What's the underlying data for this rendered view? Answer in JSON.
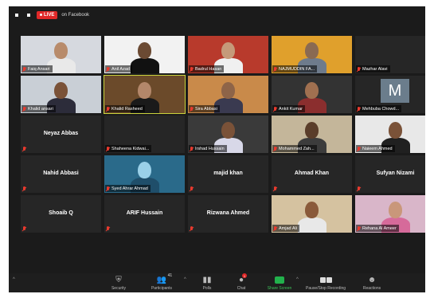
{
  "live": {
    "badge": "LIVE",
    "destination": "on Facebook"
  },
  "participants": [
    {
      "name": "Faiq Ansari",
      "type": "video",
      "bg": "#d6d9df",
      "head": "#b88b6b",
      "body": "#e9e9e9"
    },
    {
      "name": "Anil Azad",
      "type": "video",
      "bg": "#f2f2f2",
      "head": "#6b4a33",
      "body": "#111111"
    },
    {
      "name": "Badrul Hasan",
      "type": "video",
      "bg": "#b83a2c",
      "head": "#c59a7a",
      "body": "#f0f0f0"
    },
    {
      "name": "NAJMUDDIN FA...",
      "type": "video",
      "bg": "#e0a02c",
      "head": "#8a6a52",
      "body": "#6e7b8c"
    },
    {
      "name": "Mazhar Alavi",
      "type": "blank"
    },
    {
      "name": "Khalid ansari",
      "type": "video",
      "bg": "#c9cfd6",
      "head": "#7a5238",
      "body": "#2c2c3a"
    },
    {
      "name": "Khalid Rasheed",
      "type": "video",
      "bg": "#6b4a2a",
      "head": "#b3876a",
      "body": "#1a1a1a",
      "active": true
    },
    {
      "name": "Sira Abbasi",
      "type": "video",
      "bg": "#c98a4a",
      "head": "#8e6448",
      "body": "#3a3a50"
    },
    {
      "name": "Ankit Kumar",
      "type": "video",
      "bg": "#333333",
      "head": "#a07050",
      "body": "#8b2e2e"
    },
    {
      "name": "Mehbuba Chowd...",
      "type": "avatar",
      "initial": "M"
    },
    {
      "name": "Neyaz Abbas",
      "type": "text"
    },
    {
      "name": "Shaheena Kidwai...",
      "type": "blank"
    },
    {
      "name": "Irshad Hussain",
      "type": "video",
      "bg": "#3a3a3a",
      "head": "#7a5238",
      "body": "#d8d8e8"
    },
    {
      "name": "Mohammed Zah...",
      "type": "video",
      "bg": "#c4b69a",
      "head": "#5a3d2a",
      "body": "#3c3c3c"
    },
    {
      "name": "Naieem Ahmed",
      "type": "video",
      "bg": "#e8e8e8",
      "head": "#7a5238",
      "body": "#202020"
    },
    {
      "name": "Nahid Abbasi",
      "type": "text"
    },
    {
      "name": "Syed Ahrar Ahmad",
      "type": "video",
      "bg": "#2a6a8a",
      "head": "#9ad0e8",
      "body": "#1f4e6a"
    },
    {
      "name": "majid khan",
      "type": "text"
    },
    {
      "name": "Ahmad Khan",
      "type": "text"
    },
    {
      "name": "Sufyan Nizami",
      "type": "text"
    },
    {
      "name": "Shoaib Q",
      "type": "text"
    },
    {
      "name": "ARIF Hussain",
      "type": "text"
    },
    {
      "name": "Rizwana Ahmed",
      "type": "text"
    },
    {
      "name": "Amjad Ali",
      "type": "video",
      "bg": "#d5c2a0",
      "head": "#8a5a3a",
      "body": "#e8e8e8"
    },
    {
      "name": "Rehana Al Ameer",
      "type": "video",
      "bg": "#d9b6c9",
      "head": "#c9977a",
      "body": "#d66a9a"
    }
  ],
  "toolbar": {
    "security": "Security",
    "participants": "Participants",
    "participants_count": "41",
    "polls": "Polls",
    "chat": "Chat",
    "chat_badge": "1",
    "share_screen": "Share Screen",
    "record": "Pause/Stop Recording",
    "reactions": "Reactions"
  },
  "colors": {
    "live": "#e02828",
    "active_speaker": "#c9d23c",
    "share_green": "#22b14c",
    "muted_mic": "#e83a2e"
  }
}
